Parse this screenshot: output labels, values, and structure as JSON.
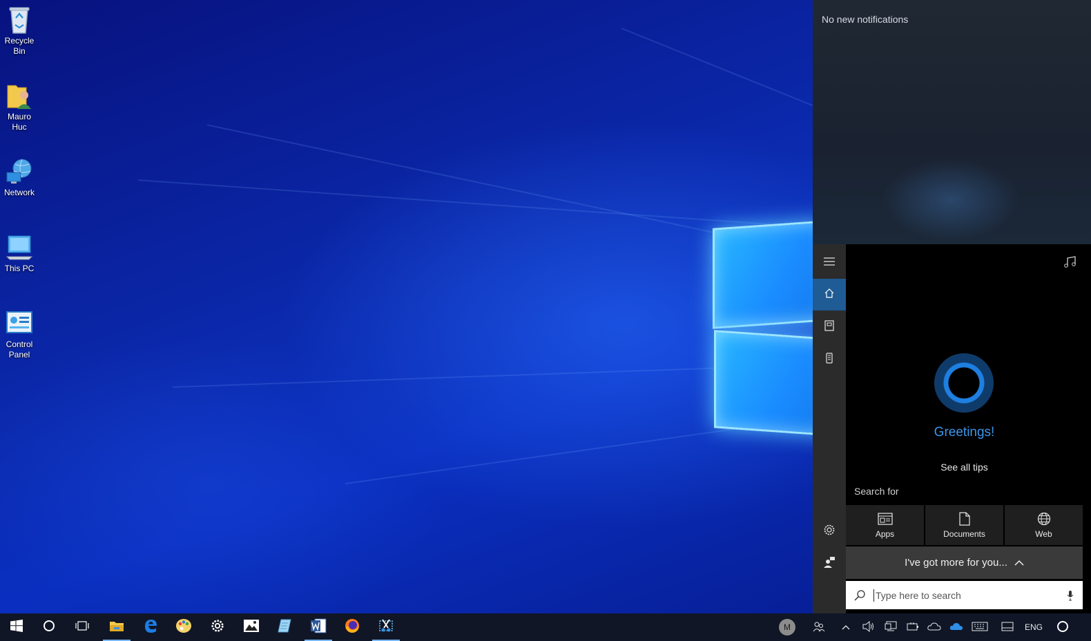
{
  "desktop": {
    "icons": [
      {
        "label": "Recycle\nBin",
        "icon": "recycle-bin-icon"
      },
      {
        "label": "Mauro\nHuc",
        "icon": "user-folder-icon"
      },
      {
        "label": "Network",
        "icon": "network-icon"
      },
      {
        "label": "This PC",
        "icon": "this-pc-icon"
      },
      {
        "label": "Control\nPanel",
        "icon": "control-panel-icon"
      }
    ]
  },
  "action_center": {
    "message": "No new notifications"
  },
  "cortana": {
    "greeting": "Greetings!",
    "see_all_tips": "See all tips",
    "search_for": "Search for",
    "filters": [
      {
        "label": "Apps",
        "icon": "apps-icon"
      },
      {
        "label": "Documents",
        "icon": "document-icon"
      },
      {
        "label": "Web",
        "icon": "globe-icon"
      }
    ],
    "more_label": "I've got more for you...",
    "search_placeholder": "Type here to search",
    "accent": "#3d95ea"
  },
  "taskbar": {
    "avatar_initial": "M",
    "language": "ENG",
    "pinned": [
      "start",
      "search",
      "task-view",
      "file-explorer",
      "edge",
      "paint",
      "settings",
      "photos",
      "notepad",
      "word",
      "firefox",
      "snip"
    ],
    "background": "#101626"
  }
}
